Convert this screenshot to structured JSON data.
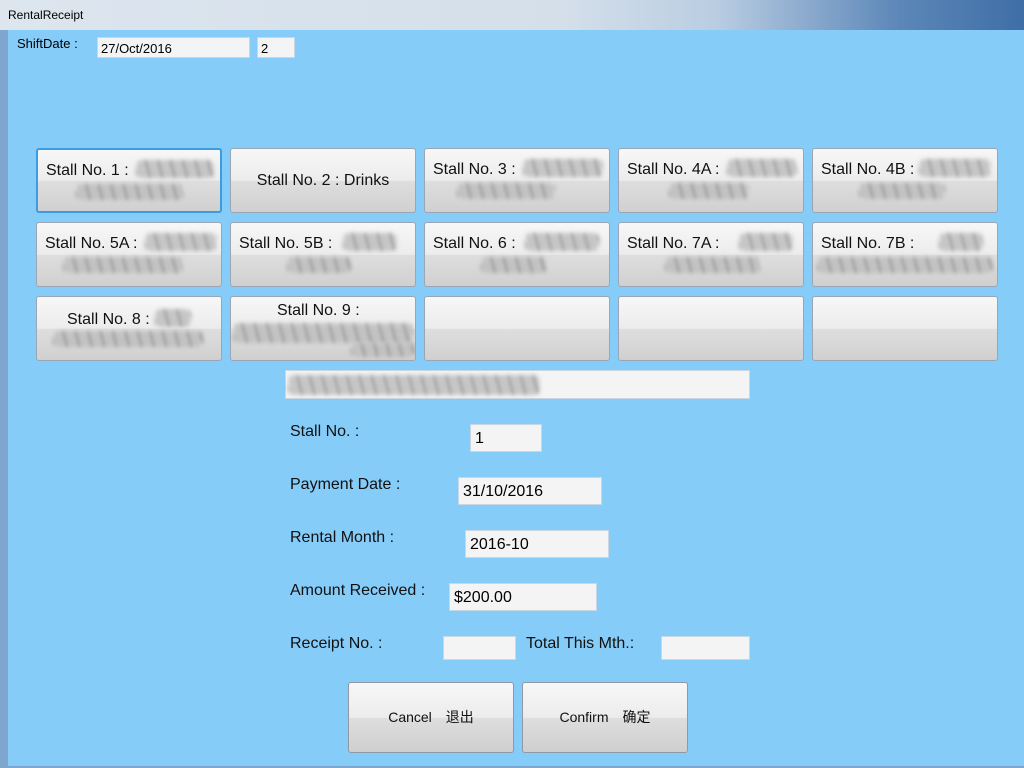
{
  "window": {
    "title": "RentalReceipt"
  },
  "shift": {
    "label": "ShiftDate :",
    "date": "27/Oct/2016",
    "number": "2"
  },
  "stalls": [
    {
      "label": "Stall No. 1 :",
      "selected": true
    },
    {
      "label": "Stall No. 2 : Drinks"
    },
    {
      "label": "Stall No. 3 :"
    },
    {
      "label": "Stall No. 4A :"
    },
    {
      "label": "Stall No. 4B :"
    },
    {
      "label": "Stall No. 5A :"
    },
    {
      "label": "Stall No. 5B :"
    },
    {
      "label": "Stall No. 6 :"
    },
    {
      "label": "Stall No. 7A :"
    },
    {
      "label": "Stall No. 7B :"
    },
    {
      "label": "Stall No. 8 :"
    },
    {
      "label": "Stall No. 9 :"
    },
    {
      "label": ""
    },
    {
      "label": ""
    },
    {
      "label": ""
    }
  ],
  "form": {
    "stall_no_label": "Stall No. :",
    "stall_no_value": "1",
    "payment_date_label": "Payment Date :",
    "payment_date_value": "31/10/2016",
    "rental_month_label": "Rental Month :",
    "rental_month_value": "2016-10",
    "amount_label": "Amount Received :",
    "amount_value": "$200.00",
    "receipt_label": "Receipt No. :",
    "receipt_value": "",
    "total_label": "Total This Mth.:",
    "total_value": ""
  },
  "actions": {
    "cancel_en": "Cancel",
    "cancel_zh": "退出",
    "confirm_en": "Confirm",
    "confirm_zh": "确定"
  },
  "colors": {
    "background": "#86ccf9",
    "selected_border": "#3d9be0"
  }
}
